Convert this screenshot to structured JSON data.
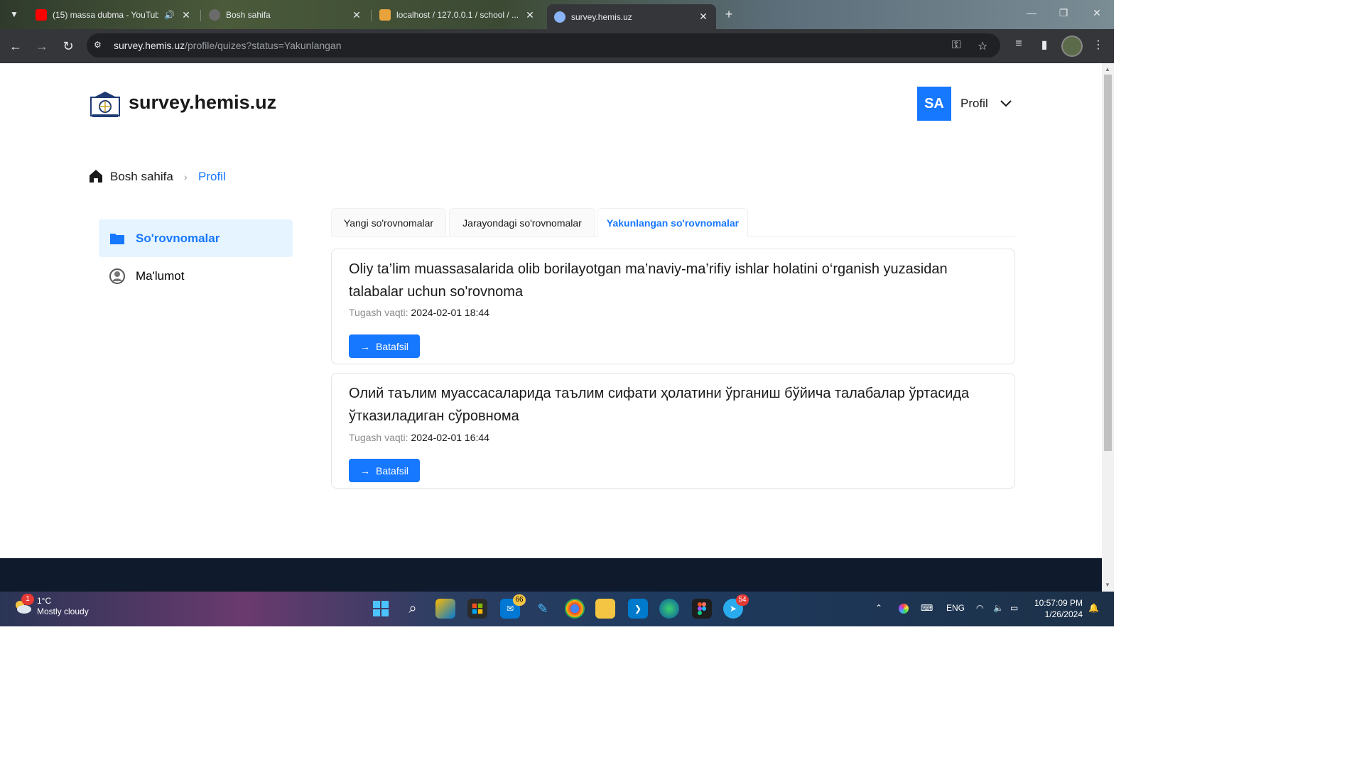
{
  "browser": {
    "tabs": [
      {
        "title": "(15) massa dubma - YouTube",
        "audio_icon": "speaker-icon"
      },
      {
        "title": "Bosh sahifa"
      },
      {
        "title": "localhost / 127.0.0.1 / school / ..."
      },
      {
        "title": "survey.hemis.uz",
        "active": true
      }
    ],
    "url_host": "survey.hemis.uz",
    "url_path": "/profile/quizes?status=Yakunlangan"
  },
  "header": {
    "brand": "survey.hemis.uz",
    "avatar_initials": "SA",
    "profile_label": "Profil"
  },
  "breadcrumb": {
    "home": "Bosh sahifa",
    "current": "Profil"
  },
  "sidebar": {
    "items": [
      {
        "label": "So'rovnomalar",
        "icon": "folder-icon",
        "active": true
      },
      {
        "label": "Ma'lumot",
        "icon": "user-circle-icon",
        "active": false
      }
    ]
  },
  "tabs": [
    {
      "label": "Yangi so'rovnomalar"
    },
    {
      "label": "Jarayondagi so'rovnomalar"
    },
    {
      "label": "Yakunlangan so'rovnomalar",
      "active": true
    }
  ],
  "surveys": [
    {
      "title": "Oliy ta’lim muassasalarida olib borilayotgan ma’naviy-ma’rifiy ishlar holatini o‘rganish yuzasidan talabalar uchun so'rovnoma",
      "deadline_label": "Tugash vaqti:",
      "deadline": "2024-02-01 18:44",
      "button": "Batafsil"
    },
    {
      "title": "Олий таълим муассасаларида таълим сифати ҳолатини ўрганиш бўйича талабалар ўртасида ўтказиладиган сўровнома",
      "deadline_label": "Tugash vaqti:",
      "deadline": "2024-02-01 16:44",
      "button": "Batafsil"
    }
  ],
  "taskbar": {
    "weather_badge": "1",
    "temperature": "1°C",
    "condition": "Mostly cloudy",
    "mail_badge": "66",
    "telegram_badge": "54",
    "language": "ENG",
    "time": "10:57:09 PM",
    "date": "1/26/2024"
  },
  "colors": {
    "accent": "#1677ff",
    "active_bg": "#e6f4ff",
    "footer": "#0f1b2d"
  }
}
